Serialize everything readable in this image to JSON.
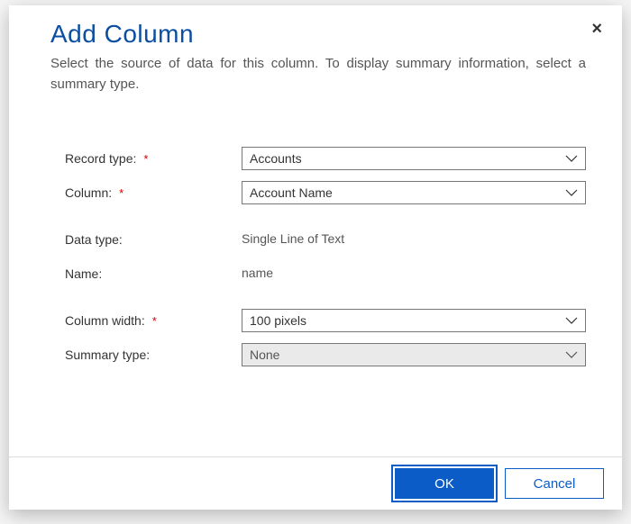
{
  "header": {
    "title": "Add Column",
    "subtitle": "Select the source of data for this column. To display summary information, select a summary type.",
    "close_label": "×"
  },
  "fields": {
    "record_type": {
      "label": "Record type:",
      "value": "Accounts",
      "required": true
    },
    "column": {
      "label": "Column:",
      "value": "Account Name",
      "required": true
    },
    "data_type": {
      "label": "Data type:",
      "value": "Single Line of Text"
    },
    "name": {
      "label": "Name:",
      "value": "name"
    },
    "column_width": {
      "label": "Column width:",
      "value": "100 pixels",
      "required": true
    },
    "summary_type": {
      "label": "Summary type:",
      "value": "None",
      "disabled": true
    }
  },
  "footer": {
    "ok_label": "OK",
    "cancel_label": "Cancel"
  },
  "required_marker": "*"
}
